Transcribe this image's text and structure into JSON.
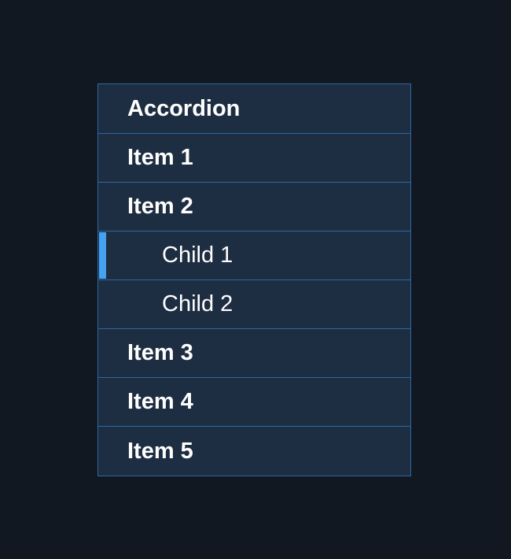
{
  "accordion": {
    "title": "Accordion",
    "items": [
      {
        "label": "Item 1"
      },
      {
        "label": "Item 2",
        "children": [
          {
            "label": "Child 1",
            "selected": true
          },
          {
            "label": "Child 2",
            "selected": false
          }
        ]
      },
      {
        "label": "Item 3"
      },
      {
        "label": "Item 4"
      },
      {
        "label": "Item 5"
      }
    ]
  },
  "colors": {
    "page_background": "#111822",
    "panel_background": "#1e2e42",
    "border": "#2d67a3",
    "selected_indicator": "#43a3f2",
    "text": "#ffffff"
  }
}
